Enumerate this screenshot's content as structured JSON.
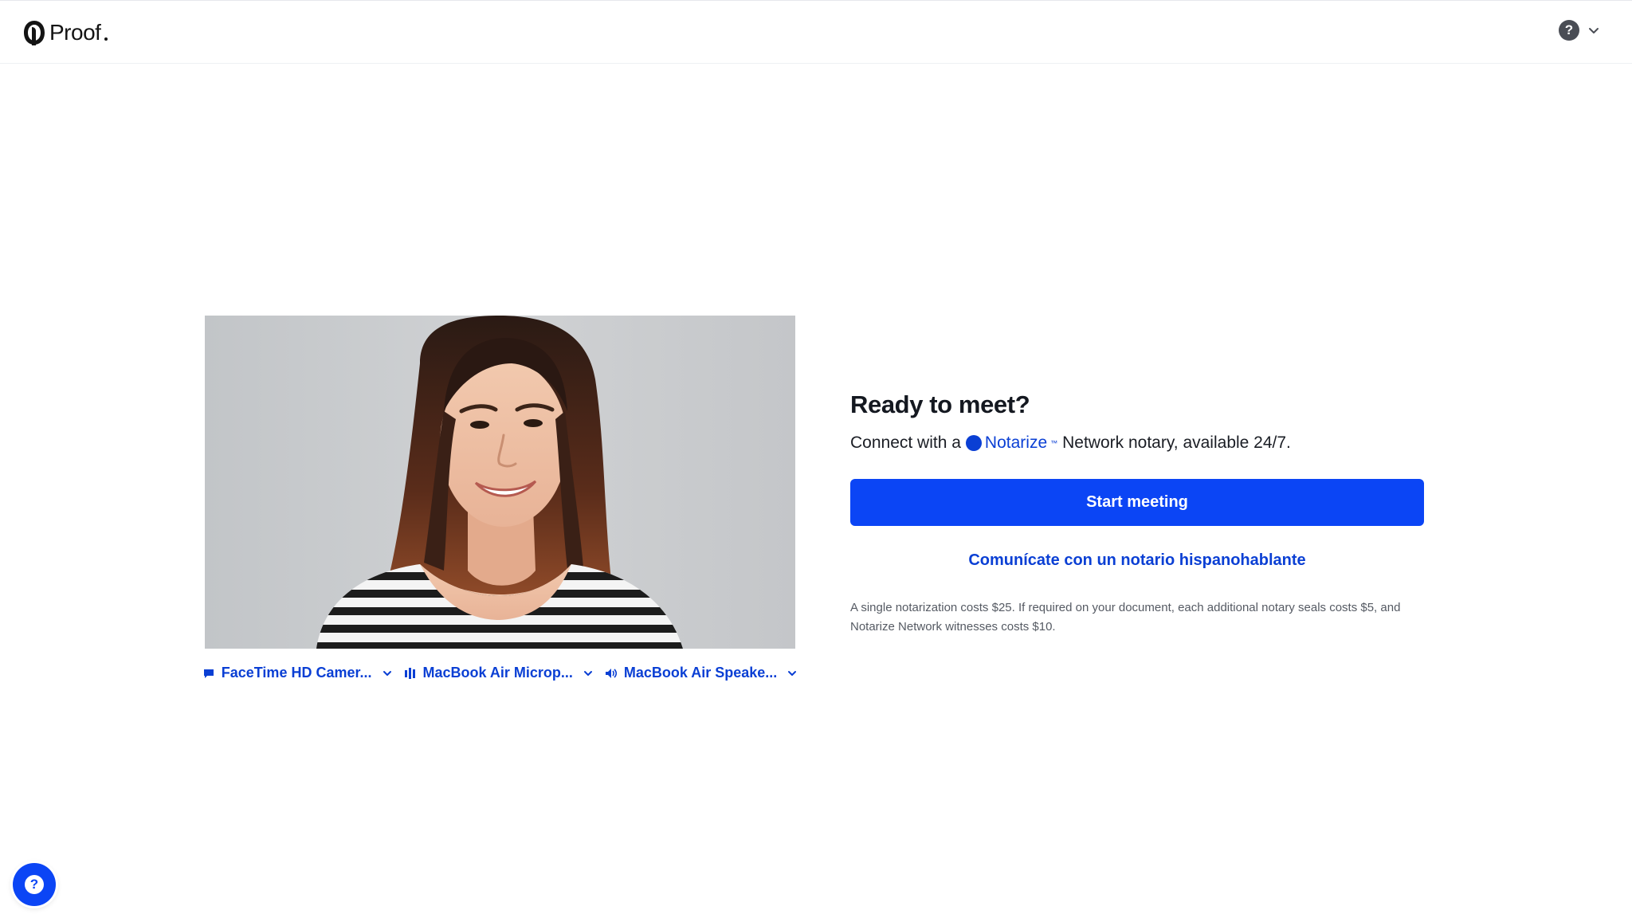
{
  "header": {
    "logo_text": "Proof",
    "help_icon": "question-circle-icon",
    "menu_icon": "chevron-down-icon"
  },
  "preview": {
    "image": "webcam-preview-woman-smiling",
    "devices": [
      {
        "icon": "camera-icon",
        "label": "FaceTime HD Camer..."
      },
      {
        "icon": "microphone-icon",
        "label": "MacBook Air Microp..."
      },
      {
        "icon": "speaker-icon",
        "label": "MacBook Air Speake..."
      }
    ]
  },
  "panel": {
    "title": "Ready to meet?",
    "subtitle_before": "Connect with a",
    "brand_name": "Notarize",
    "subtitle_after": "Network notary, available 24/7.",
    "start_button": "Start meeting",
    "spanish_link": "Comunícate con un notario hispanohablante",
    "fine_print": "A single notarization costs $25. If required on your document, each additional notary seals costs $5, and Notarize Network witnesses costs $10."
  },
  "support": {
    "icon": "help-bubble-icon"
  },
  "colors": {
    "accent": "#0b45f5",
    "link": "#0a3fd4",
    "text": "#1a1d24",
    "muted": "#555a63"
  }
}
